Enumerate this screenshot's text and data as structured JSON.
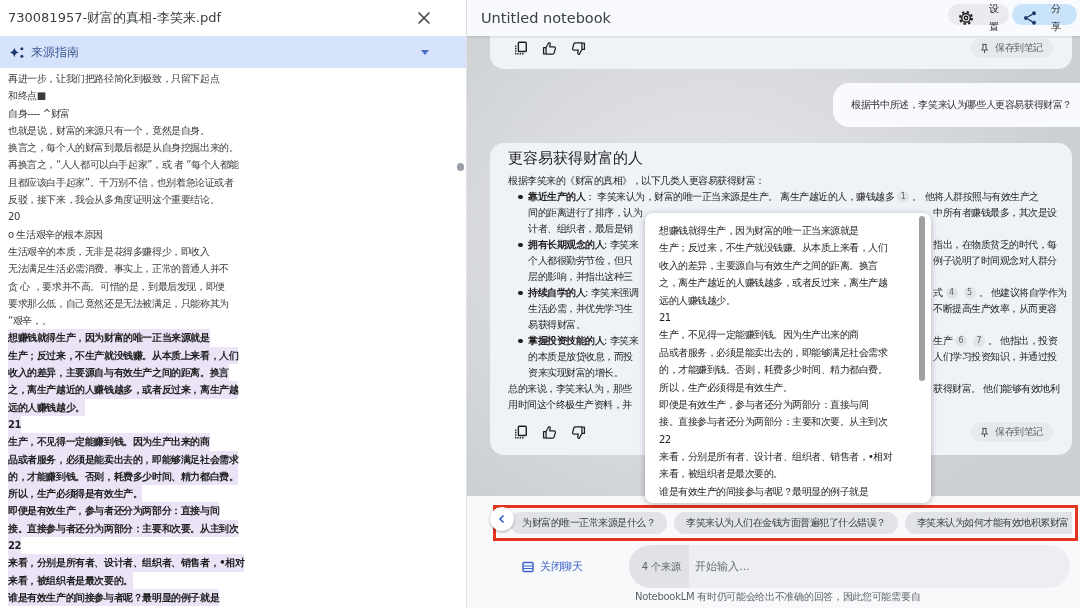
{
  "source_panel": {
    "title": "730081957-财富的真相-李笑来.pdf",
    "guide_label": "来源指南",
    "lines": [
      {
        "text": "再进一步，让我们把路径简化到极致，只留下起点",
        "highlighted": false
      },
      {
        "text": "和终点■",
        "highlighted": false
      },
      {
        "text": "自身---- ^财富",
        "highlighted": false
      },
      {
        "text": "也就是说，财富的来源只有一个，竟然是自身。",
        "highlighted": false
      },
      {
        "text": "换言之，每个人的财富到最后都是从自身挖掘出来的。",
        "highlighted": false
      },
      {
        "text": "再换言之，“人人都可以白手起家”，或 者 “每个人都能",
        "highlighted": false
      },
      {
        "text": "且都应该白手起家”。千万别不信，也别着急论证或者",
        "highlighted": false
      },
      {
        "text": "反驳，接下来，我会从多角度证明这个重要结论。",
        "highlighted": false
      },
      {
        "text": "20",
        "highlighted": false
      },
      {
        "text": "o 生活艰辛的根本原因",
        "highlighted": false
      },
      {
        "text": "生活艰辛的本质，无非是花得多赚得少，即收入",
        "highlighted": false
      },
      {
        "text": "无法满足生活必需消费。事实上，正常的普通人并不",
        "highlighted": false
      },
      {
        "text": "贪 心 ，要求并不高。可惜的是，到最后发现，即便",
        "highlighted": false
      },
      {
        "text": "要求那么低，自己竟然还是无法被满足，只能称其为",
        "highlighted": false
      },
      {
        "text": "“艰辛，。",
        "highlighted": false
      },
      {
        "text": "想赚钱就得生产，因为财富的唯一正当来源就是",
        "highlighted": true
      },
      {
        "text": "生产；反过来，不生产就没钱赚。从本质上来看，人们",
        "highlighted": true
      },
      {
        "text": "收入的差异，主要源自与有效生产之间的距离。换言",
        "highlighted": true
      },
      {
        "text": "之，离生产越近的人赚钱越多，或者反过来，离生产越",
        "highlighted": true
      },
      {
        "text": "远的人赚钱越少。",
        "highlighted": true
      },
      {
        "text": "21",
        "highlighted": true
      },
      {
        "text": "生产，不见得一定能赚到钱。因为生产出来的商",
        "highlighted": true
      },
      {
        "text": "品或者服务，必须是能卖出去的，即能够满足社会需求",
        "highlighted": true
      },
      {
        "text": "的，才能赚到钱。否则，耗费多少时间、精力都白费。",
        "highlighted": true
      },
      {
        "text": "所以，生产必须得是有效生产。",
        "highlighted": true
      },
      {
        "text": "即便是有效生产，参与者还分为两部分：直接与间",
        "highlighted": true
      },
      {
        "text": "接。直接参与者还分为两部分：主要和次要。从主到次",
        "highlighted": true
      },
      {
        "text": "22",
        "highlighted": true
      },
      {
        "text": "来看，分别是所有者、设计者、组织者、销售者，•相对",
        "highlighted": true
      },
      {
        "text": "来看，被组织者是最次要的。",
        "highlighted": true
      },
      {
        "text": "谁是有效生产的间接参与者呢？最明显的例子就是",
        "highlighted": true
      }
    ]
  },
  "notebook": {
    "title": "Untitled notebook",
    "actions": [
      {
        "kind": "settings",
        "label": "设置"
      },
      {
        "kind": "share",
        "label": "分享"
      }
    ]
  },
  "chat": {
    "items": [
      {
        "kind": "answer_end",
        "save_label": "保存到笔记"
      },
      {
        "kind": "question",
        "text": "根据书中所述，李笑来认为哪些人更容易获得财富？"
      },
      {
        "kind": "answer",
        "title": "更容易获得财富的人",
        "save_label": "保存到笔记",
        "lines": [
          {
            "kind": "plain",
            "left": [
              {
                "kind": "text",
                "text": "根据李笑来的《财富的真相》，以下几类人更容易获得财富："
              }
            ]
          },
          {
            "kind": "bullet",
            "left": [
              {
                "kind": "text",
                "text": "**靠近生产的人**： 李笑来认为，财富的唯一正当来源是生产。 离生产越近的人，赚钱越多"
              },
              {
                "kind": "citation",
                "text": "1"
              },
              {
                "kind": "text",
                "text": "。 他将人群按照与有效生产之"
              }
            ]
          },
          {
            "kind": "continuation",
            "left": [
              {
                "kind": "text",
                "text": "间的距离进行了排序，认为"
              }
            ],
            "right": [
              {
                "kind": "text",
                "text": "中所有者赚钱最多，其次是设"
              }
            ]
          },
          {
            "kind": "continuation",
            "left": [
              {
                "kind": "text",
                "text": "计者、组织者，最后是销"
              }
            ]
          },
          {
            "kind": "bullet",
            "left": [
              {
                "kind": "text",
                "text": "**拥有长期观念的人**: 李笑来"
              }
            ],
            "right": [
              {
                "kind": "text",
                "text": "指出，在物质贫乏的时代，每"
              }
            ]
          },
          {
            "kind": "continuation",
            "left": [
              {
                "kind": "text",
                "text": "个人都很勤劳节俭，但只"
              }
            ],
            "right": [
              {
                "kind": "text",
                "text": "例子说明了时间观念对人群分"
              }
            ]
          },
          {
            "kind": "continuation",
            "left": [
              {
                "kind": "text",
                "text": "层的影响，并指出这种三"
              }
            ]
          },
          {
            "kind": "bullet",
            "left": [
              {
                "kind": "text",
                "text": "**持续自学的人**: 李笑来强调"
              }
            ],
            "right": [
              {
                "kind": "text",
                "text": "式"
              },
              {
                "kind": "citation",
                "text": "4"
              },
              {
                "kind": "citation",
                "text": "5"
              },
              {
                "kind": "text",
                "text": "。 他建议将自学作为"
              }
            ]
          },
          {
            "kind": "continuation",
            "left": [
              {
                "kind": "text",
                "text": "生活必需，并优先学习生"
              }
            ],
            "right": [
              {
                "kind": "text",
                "text": "不断提高生产效率，从而更容"
              }
            ]
          },
          {
            "kind": "continuation",
            "left": [
              {
                "kind": "text",
                "text": "易获得财富。"
              }
            ]
          },
          {
            "kind": "bullet",
            "left": [
              {
                "kind": "text",
                "text": "**掌握投资技能的人**: 李笑来"
              }
            ],
            "right": [
              {
                "kind": "text",
                "text": "生产"
              },
              {
                "kind": "citation",
                "text": "6"
              },
              {
                "kind": "citation",
                "text": "7"
              },
              {
                "kind": "text",
                "text": "。 他指出，投资"
              }
            ]
          },
          {
            "kind": "continuation",
            "left": [
              {
                "kind": "text",
                "text": "的本质是放贷收息，而投"
              }
            ],
            "right": [
              {
                "kind": "text",
                "text": "人们学习投资知识，并通过投"
              }
            ]
          },
          {
            "kind": "continuation",
            "left": [
              {
                "kind": "text",
                "text": "资来实现财富的增长。"
              }
            ]
          },
          {
            "kind": "plain",
            "left": [
              {
                "kind": "text",
                "text": "总的来说，李笑来认为，那些"
              }
            ],
            "right": [
              {
                "kind": "text",
                "text": "获得财富。 他们能够有效地利"
              }
            ]
          },
          {
            "kind": "plain",
            "left": [
              {
                "kind": "text",
                "text": "用时间这个终极生产资料，并"
              }
            ]
          }
        ]
      }
    ]
  },
  "source_popup": {
    "lines": [
      "想赚钱就得生产，因为财富的唯一正当来源就是",
      "生产；反过来，不生产就没钱赚。从本质上来看，人们",
      "收入的差异，主要源自与有效生产之间的距离。换言",
      "之，离生产越近的人赚钱越多，或者反过来，离生产越",
      "远的人赚钱越少。",
      "21",
      "生产，不见得一定能赚到钱。因为生产出来的商",
      "品或者服务，必须是能卖出去的，即能够满足社会需求",
      "的，才能赚到钱。否则，耗费多少时间、精力都白费。",
      "所以，生产必须得是有效生产。",
      "即便是有效生产，参与者还分为两部分：直接与间",
      "接。直接参与者还分为两部分：主要和次要。从主到次",
      "22",
      "来看，分别是所有者、设计者、组织者、销售者，•相对",
      "来看，被组织者是最次要的。",
      "谁是有效生产的间接参与者呢？最明显的例子就是"
    ]
  },
  "suggestions": {
    "highlighted": true,
    "items": [
      "为财富的唯一正常来源是什么？",
      "李笑来认为人们在金钱方面普遍犯了什么错误？",
      "李笑来认为如何才能有效地积累财富"
    ]
  },
  "composer": {
    "close_label": "关闭聊天",
    "source_count": "4 个来源",
    "placeholder": "开始输入...",
    "disclaimer": "NotebookLM 有时仍可能会给出不准确的回答，因此您可能需要自"
  }
}
